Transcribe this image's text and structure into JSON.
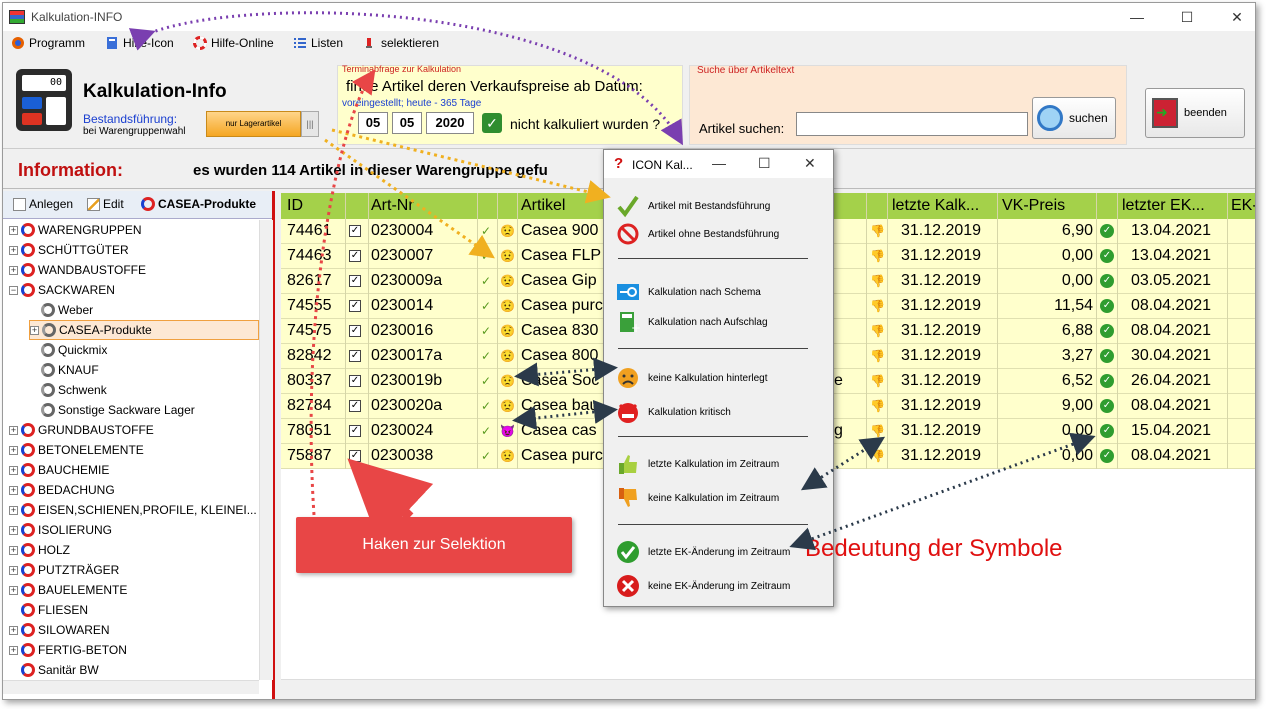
{
  "window": {
    "title": "Kalkulation-INFO"
  },
  "menu": {
    "items": [
      "Programm",
      "Hilfe-Icon",
      "Hilfe-Online",
      "Listen",
      "selektieren"
    ]
  },
  "header": {
    "app_title": "Kalkulation-Info",
    "calc_display": "00",
    "bestand_label": "Bestandsführung:",
    "gruppenwahl_label": "bei Warengruppenwahl",
    "lager_button": "nur Lagerartikel",
    "termin": {
      "caption": "Terminabfrage zur Kalkulation",
      "question1": "finde Artikel deren Verkaufspreise ab Datum:",
      "voreingestellt": "voreingestellt; heute - 365 Tage",
      "day": "05",
      "month": "05",
      "year": "2020",
      "question2": "nicht kalkuliert wurden ?"
    },
    "suche": {
      "caption": "Suche über Artikeltext",
      "label": "Artikel suchen:",
      "input_value": "",
      "button": "suchen"
    },
    "beenden_button": "beenden"
  },
  "info": {
    "label": "Information:",
    "message": "es wurden 114 Artikel in dieser Warengruppe gefu"
  },
  "left": {
    "toolbar": {
      "anlegen": "Anlegen",
      "edit": "Edit",
      "current": "CASEA-Produkte"
    },
    "tree": [
      {
        "label": "WARENGRUPPEN",
        "level": 0,
        "expander": "+"
      },
      {
        "label": "SCHÜTTGÜTER",
        "level": 0,
        "expander": "+"
      },
      {
        "label": "WANDBAUSTOFFE",
        "level": 0,
        "expander": "+"
      },
      {
        "label": "SACKWAREN",
        "level": 0,
        "expander": "−"
      },
      {
        "label": "Weber",
        "level": 1,
        "expander": ""
      },
      {
        "label": "CASEA-Produkte",
        "level": 1,
        "expander": "+",
        "selected": true
      },
      {
        "label": "Quickmix",
        "level": 1,
        "expander": ""
      },
      {
        "label": "KNAUF",
        "level": 1,
        "expander": ""
      },
      {
        "label": "Schwenk",
        "level": 1,
        "expander": ""
      },
      {
        "label": "Sonstige Sackware Lager",
        "level": 1,
        "expander": ""
      },
      {
        "label": "GRUNDBAUSTOFFE",
        "level": 0,
        "expander": "+"
      },
      {
        "label": "BETONELEMENTE",
        "level": 0,
        "expander": "+"
      },
      {
        "label": "BAUCHEMIE",
        "level": 0,
        "expander": "+"
      },
      {
        "label": "BEDACHUNG",
        "level": 0,
        "expander": "+"
      },
      {
        "label": "EISEN,SCHIENEN,PROFILE,  KLEINEI...",
        "level": 0,
        "expander": "+"
      },
      {
        "label": "ISOLIERUNG",
        "level": 0,
        "expander": "+"
      },
      {
        "label": "HOLZ",
        "level": 0,
        "expander": "+"
      },
      {
        "label": "PUTZTRÄGER",
        "level": 0,
        "expander": "+"
      },
      {
        "label": "BAUELEMENTE",
        "level": 0,
        "expander": "+"
      },
      {
        "label": "FLIESEN",
        "level": 0,
        "expander": ""
      },
      {
        "label": "SILOWAREN",
        "level": 0,
        "expander": "+"
      },
      {
        "label": "FERTIG-BETON",
        "level": 0,
        "expander": "+"
      },
      {
        "label": "Sanitär BW",
        "level": 0,
        "expander": ""
      }
    ]
  },
  "grid": {
    "columns": [
      "ID",
      "Art-Nr",
      "Artikel",
      "letzte Kalk...",
      "VK-Preis",
      "letzter EK...",
      "EK-"
    ],
    "rows": [
      {
        "id": "74461",
        "art": "0230004",
        "artikel": "Casea 900",
        "extra": "",
        "kalk": "31.12.2019",
        "vk": "6,90",
        "ek": "13.04.2021",
        "status": "ok"
      },
      {
        "id": "74463",
        "art": "0230007",
        "artikel": "Casea FLP",
        "extra": "",
        "kalk": "31.12.2019",
        "vk": "0,00",
        "ek": "13.04.2021",
        "status": "ok"
      },
      {
        "id": "82617",
        "art": "0230009a",
        "artikel": "Casea  Gip",
        "extra": "",
        "kalk": "31.12.2019",
        "vk": "0,00",
        "ek": "03.05.2021",
        "status": "ok"
      },
      {
        "id": "74555",
        "art": "0230014",
        "artikel": "Casea purc",
        "extra": "",
        "kalk": "31.12.2019",
        "vk": "11,54",
        "ek": "08.04.2021",
        "status": "ok"
      },
      {
        "id": "74575",
        "art": "0230016",
        "artikel": "Casea 830",
        "extra": "",
        "kalk": "31.12.2019",
        "vk": "6,88",
        "ek": "08.04.2021",
        "status": "ok"
      },
      {
        "id": "82842",
        "art": "0230017a",
        "artikel": "Casea 800",
        "extra": "",
        "kalk": "31.12.2019",
        "vk": "3,27",
        "ek": "30.04.2021",
        "status": "ok"
      },
      {
        "id": "80337",
        "art": "0230019b",
        "artikel": "Casea  Soc",
        "extra": "e",
        "kalk": "31.12.2019",
        "vk": "6,52",
        "ek": "26.04.2021",
        "status": "ok"
      },
      {
        "id": "82784",
        "art": "0230020a",
        "artikel": "Casea bau",
        "extra": "",
        "kalk": "31.12.2019",
        "vk": "9,00",
        "ek": "08.04.2021",
        "status": "ok"
      },
      {
        "id": "78051",
        "art": "0230024",
        "artikel": "Casea cas",
        "extra": "g",
        "kalk": "31.12.2019",
        "vk": "0,00",
        "ek": "15.04.2021",
        "status": "crit"
      },
      {
        "id": "75887",
        "art": "0230038",
        "artikel": "Casea purc",
        "extra": "",
        "kalk": "31.12.2019",
        "vk": "0,00",
        "ek": "08.04.2021",
        "status": "ok"
      }
    ]
  },
  "popup": {
    "title": "ICON Kal...",
    "items": [
      "Artikel mit Bestandsführung",
      "Artikel ohne Bestandsführung",
      "Kalkulation nach Schema",
      "Kalkulation nach Aufschlag",
      "keine Kalkulation hinterlegt",
      "Kalkulation kritisch",
      "letzte Kalkulation im Zeitraum",
      "keine Kalkulation im Zeitraum",
      "letzte EK-Änderung im Zeitraum",
      "keine EK-Änderung im Zeitraum"
    ]
  },
  "annotations": {
    "callout": "Haken zur Selektion",
    "bedeutung": "Bedeutung der Symbole"
  }
}
